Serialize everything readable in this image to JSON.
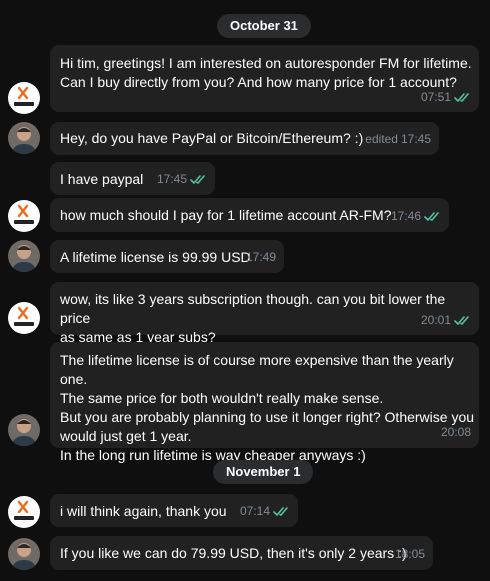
{
  "date_dividers": [
    {
      "label": "October 31"
    },
    {
      "label": "November 1"
    }
  ],
  "contacts": {
    "me": {
      "avatar_logo_text": "Aksel.in",
      "accent_color": "#f26b1d"
    },
    "tim": {
      "avatar_kind": "photo"
    }
  },
  "colors": {
    "background": "#0f0f0f",
    "bubble": "#212121",
    "date_pill": "#2b2c2e",
    "meta_text": "#828b94",
    "read_check": "#4fc3a1"
  },
  "messages": [
    {
      "sender": "me",
      "text": "Hi tim, greetings! I am interested on autoresponder FM for lifetime.\nCan I buy directly from you? And how many price for 1 account?",
      "time": "07:51",
      "edited": "",
      "read": true
    },
    {
      "sender": "tim",
      "text": "Hey, do you have PayPal or Bitcoin/Ethereum? :)",
      "time": "17:45",
      "edited": "edited",
      "read": false
    },
    {
      "sender": "me",
      "text": "I have paypal",
      "time": "17:45",
      "edited": "",
      "read": true
    },
    {
      "sender": "me",
      "text": "how much should I pay for 1 lifetime account AR-FM?",
      "time": "17:46",
      "edited": "",
      "read": true
    },
    {
      "sender": "tim",
      "text": "A lifetime license is 99.99 USD",
      "time": "17:49",
      "edited": "",
      "read": false
    },
    {
      "sender": "me",
      "text": "wow, its like 3 years subscription though. can you bit lower the price\nas same as 1 year subs?",
      "time": "20:01",
      "edited": "",
      "read": true
    },
    {
      "sender": "tim",
      "text": "The lifetime license is of course more expensive than the yearly one.\nThe same price for both wouldn't really make sense.\nBut you are probably planning to use it longer right? Otherwise you\nwould just get 1 year.\nIn the long run lifetime is way cheaper anyways :)",
      "time": "20:08",
      "edited": "",
      "read": false
    },
    {
      "sender": "me",
      "text": "i will think again, thank you",
      "time": "07:14",
      "edited": "",
      "read": true
    },
    {
      "sender": "tim",
      "text": "If you like we can do 79.99 USD, then it's only 2 years :)",
      "time": "18:05",
      "edited": "",
      "read": false
    }
  ]
}
